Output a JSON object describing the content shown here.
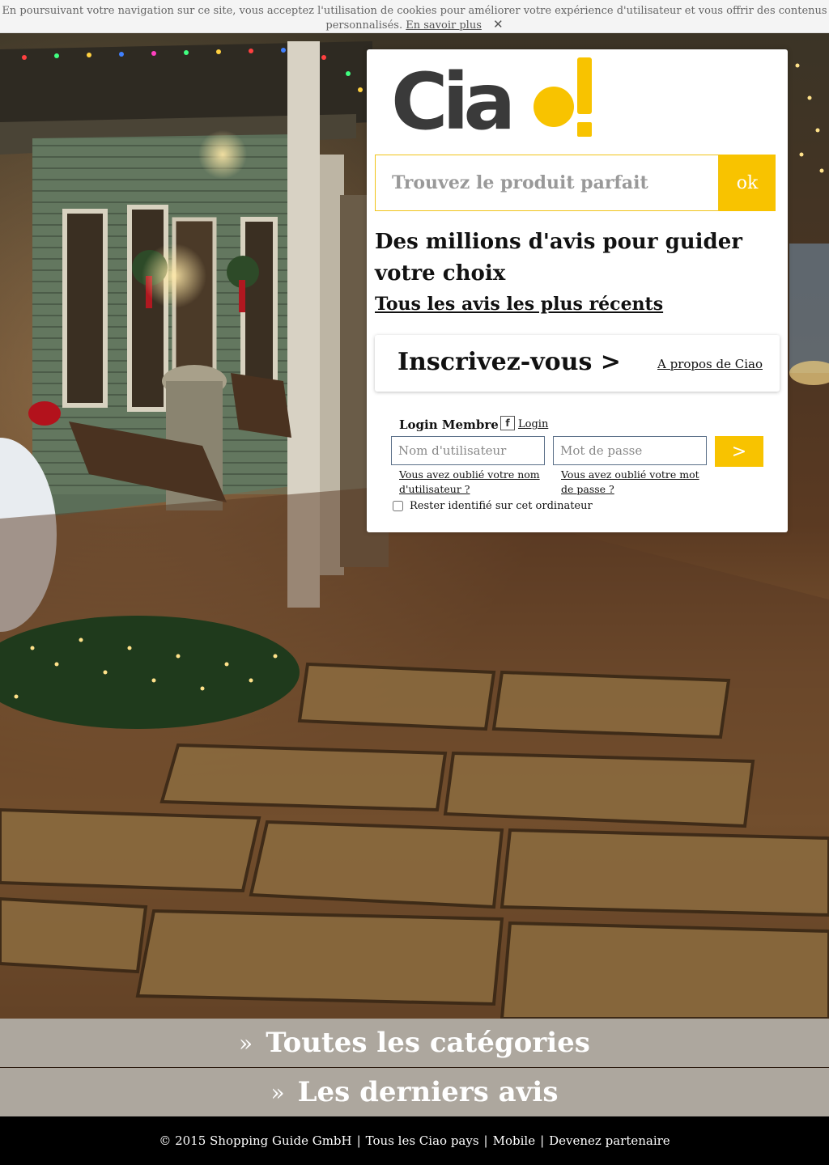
{
  "cookie": {
    "text": "En poursuivant votre navigation sur ce site, vous acceptez l'utilisation de cookies pour améliorer votre expérience d'utilisateur et vous offrir des contenus personnalisés.",
    "link": "En savoir plus",
    "close": "✕"
  },
  "logo": {
    "word": "Cia",
    "o": "o"
  },
  "search": {
    "placeholder": "Trouvez le produit parfait",
    "button": "ok"
  },
  "headline": "Des millions d'avis pour guider votre choix",
  "recent_link": "Tous les avis les plus récents",
  "signup": {
    "label": "Inscrivez-vous >",
    "about": "A propos de Ciao"
  },
  "login": {
    "title": "Login Membre",
    "fb_icon": "f",
    "fb_label": "Login",
    "user_placeholder": "Nom d'utilisateur",
    "pass_placeholder": "Mot de passe",
    "submit": ">",
    "forgot_user": "Vous avez oublié votre nom d'utilisateur ?",
    "forgot_pass": "Vous avez oublié votre mot de passe ?",
    "remember": "Rester identifié sur cet ordinateur"
  },
  "bars": {
    "arrow": "»",
    "categories": "Toutes les catégories",
    "reviews": "Les derniers avis"
  },
  "footer": {
    "copyright": "© 2015 Shopping Guide GmbH",
    "separator": "|",
    "countries": "Tous les Ciao pays",
    "mobile": "Mobile",
    "partner": "Devenez partenaire"
  },
  "colors": {
    "accent": "#f8c300",
    "logo_gray": "#3a3a3a",
    "bar": "#ada79e"
  }
}
